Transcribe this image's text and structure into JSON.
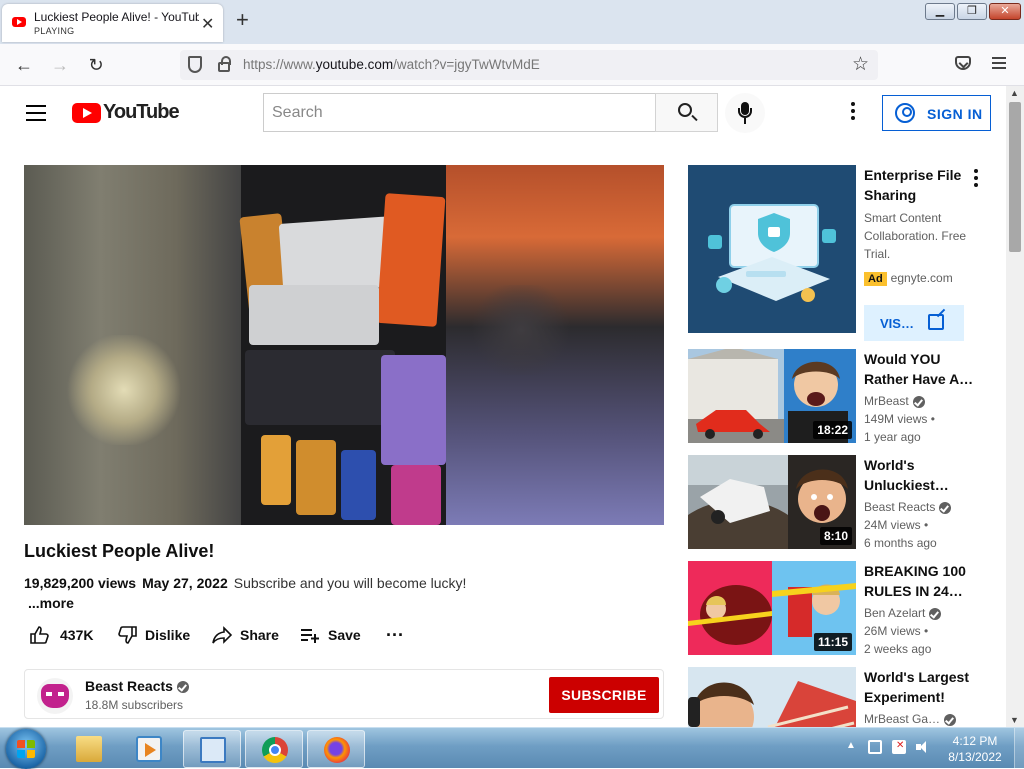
{
  "browser": {
    "tab_title": "Luckiest People Alive! - YouTube",
    "tab_status": "PLAYING",
    "url_prefix": "https://www.",
    "url_domain": "youtube.com",
    "url_path": "/watch?v=jgyTwWtvMdE"
  },
  "youtube": {
    "logo_text": "YouTube",
    "search_placeholder": "Search",
    "sign_in_label": "SIGN IN"
  },
  "video": {
    "title": "Luckiest People Alive!",
    "views": "19,829,200 views",
    "date": "May 27, 2022",
    "description": "Subscribe and you will become lucky!",
    "more_label": "...more",
    "likes": "437K",
    "dislike_label": "Dislike",
    "share_label": "Share",
    "save_label": "Save",
    "more_actions": "..."
  },
  "channel": {
    "name": "Beast Reacts",
    "subscribers": "18.8M subscribers",
    "subscribe_label": "SUBSCRIBE"
  },
  "ad": {
    "title": "Enterprise File Sharing",
    "description": "Smart Content Collaboration. Free Trial.",
    "badge": "Ad",
    "domain": "egnyte.com",
    "visit_label": "VIS…"
  },
  "recommendations": [
    {
      "title": "Would YOU Rather Have A…",
      "channel": "MrBeast",
      "views": "149M views •",
      "age": "1 year ago",
      "duration": "18:22"
    },
    {
      "title": "World's Unluckiest…",
      "channel": "Beast Reacts",
      "views": "24M views •",
      "age": "6 months ago",
      "duration": "8:10"
    },
    {
      "title": "BREAKING 100 RULES IN 24…",
      "channel": "Ben Azelart",
      "views": "26M views •",
      "age": "2 weeks ago",
      "duration": "11:15"
    },
    {
      "title": "World's Largest Experiment!",
      "channel": "MrBeast Ga…",
      "views": "",
      "age": "",
      "duration": ""
    }
  ],
  "taskbar": {
    "time": "4:12 PM",
    "date": "8/13/2022"
  },
  "colors": {
    "youtube_red": "#ff0000",
    "subscribe_red": "#cc0000",
    "link_blue": "#065fd4",
    "ad_badge": "#fbc02d"
  }
}
